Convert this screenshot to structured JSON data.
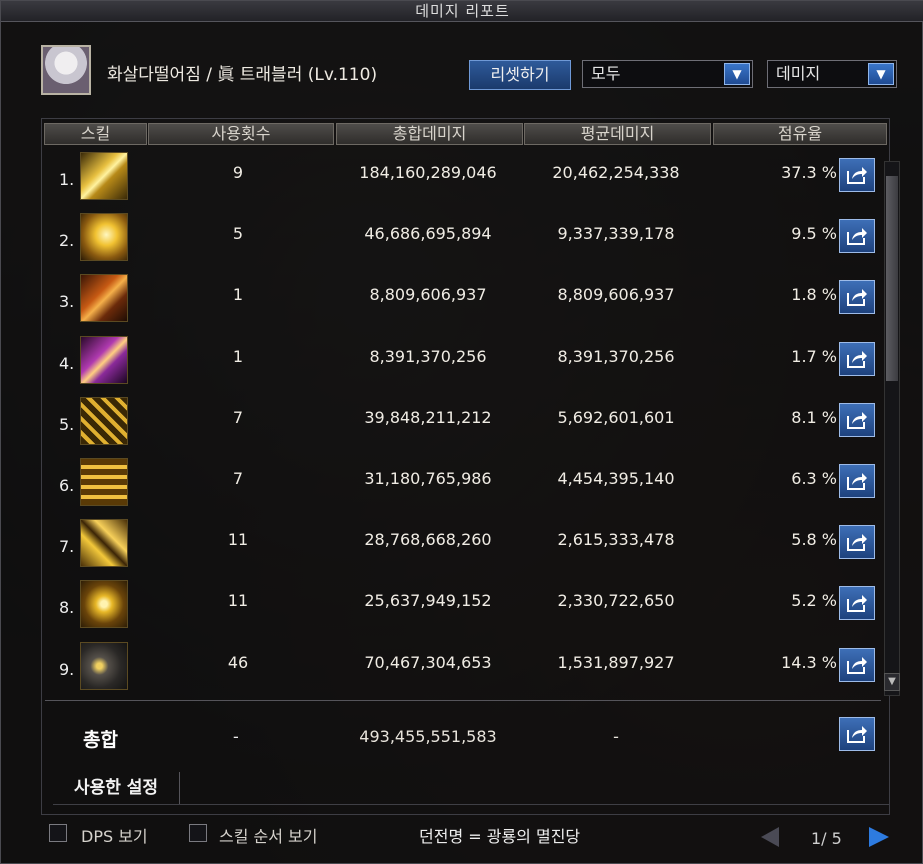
{
  "window": {
    "title": "데미지 리포트"
  },
  "character": {
    "name": "화살다떨어짐 / 眞 트래블러 (Lv.110)"
  },
  "toolbar": {
    "reset_label": "리셋하기",
    "filter_select": "모두",
    "metric_select": "데미지"
  },
  "table": {
    "headers": [
      "스킬",
      "사용횟수",
      "총합데미지",
      "평균데미지",
      "점유율"
    ],
    "rows": [
      {
        "num": "1.",
        "icon": "golden-arrows-icon",
        "count": "9",
        "total": "184,160,289,046",
        "avg": "20,462,254,338",
        "share": "37.3 %"
      },
      {
        "num": "2.",
        "icon": "golden-burst-icon",
        "count": "5",
        "total": "46,686,695,894",
        "avg": "9,337,339,178",
        "share": "9.5 %"
      },
      {
        "num": "3.",
        "icon": "fire-blade-icon",
        "count": "1",
        "total": "8,809,606,937",
        "avg": "8,809,606,937",
        "share": "1.8 %"
      },
      {
        "num": "4.",
        "icon": "magenta-strike-icon",
        "count": "1",
        "total": "8,391,370,256",
        "avg": "8,391,370,256",
        "share": "1.7 %"
      },
      {
        "num": "5.",
        "icon": "crossed-swords-icon",
        "count": "7",
        "total": "39,848,211,212",
        "avg": "5,692,601,601",
        "share": "8.1 %"
      },
      {
        "num": "6.",
        "icon": "golden-rail-icon",
        "count": "7",
        "total": "31,180,765,986",
        "avg": "4,454,395,140",
        "share": "6.3 %"
      },
      {
        "num": "7.",
        "icon": "golden-slash-icon",
        "count": "11",
        "total": "28,768,668,260",
        "avg": "2,615,333,478",
        "share": "5.8 %"
      },
      {
        "num": "8.",
        "icon": "golden-star-icon",
        "count": "11",
        "total": "25,637,949,152",
        "avg": "2,330,722,650",
        "share": "5.2 %"
      },
      {
        "num": "9.",
        "icon": "dark-star-icon",
        "count": "46",
        "total": "70,467,304,653",
        "avg": "1,531,897,927",
        "share": "14.3 %"
      }
    ]
  },
  "summary": {
    "label": "총합",
    "count": "-",
    "total": "493,455,551,583",
    "avg": "-"
  },
  "tabs": {
    "used_setting": "사용한 설정"
  },
  "footer": {
    "dps_label": "DPS 보기",
    "skill_order_label": "스킬 순서 보기",
    "dungeon": "던전명 = 광룡의 멸진당",
    "page": "1/ 5"
  },
  "colors": {
    "accent": "#2f5fa8",
    "header_bg": "#3e3c39",
    "panel_bg": "#0c0c0e"
  }
}
